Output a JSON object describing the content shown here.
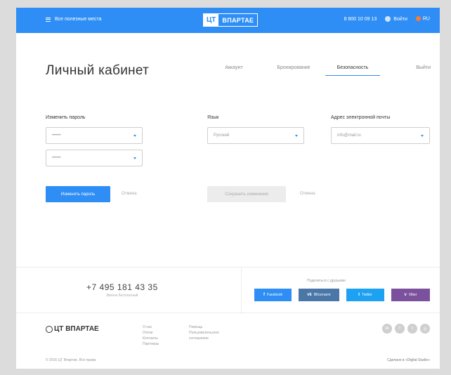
{
  "header": {
    "menu_label": "Все полезные места",
    "logo_a": "ЦТ",
    "logo_b": "ВПАРТАЕ",
    "phone": "8 800 10 09 13",
    "user": "Войти",
    "lang": "RU"
  },
  "page": {
    "title": "Личный кабинет",
    "tabs": [
      "Аккаунт",
      "Бронирование",
      "Безопасность",
      "Выйти"
    ]
  },
  "form": {
    "password_label": "Изменить пароль",
    "password_field_1": "••••••",
    "password_field_2": "••••••",
    "lang_label": "Язык",
    "lang_value": "Русский",
    "email_label": "Адрес электронной почты",
    "email_value": "info@mail.ru",
    "change_password_button": "Изменить пароль",
    "cancel_1": "Отмена",
    "save_changes_button": "Сохранить изменения",
    "cancel_2": "Отмена"
  },
  "footer": {
    "phone": "+7 495 181 43 35",
    "phone_sub": "Звонок бесплатный",
    "share_title": "Поделиться с друзьями",
    "share_buttons": [
      {
        "label": "Facebook",
        "icon": "f",
        "color": "#2f8ef5"
      },
      {
        "label": "ВКонтакте",
        "icon": "vk",
        "color": "#4a76a8"
      },
      {
        "label": "Twitter",
        "icon": "t",
        "color": "#1da1f2"
      },
      {
        "label": "Viber",
        "icon": "v",
        "color": "#7b519d"
      }
    ],
    "logo": "ЦТ ВПАРТАЕ",
    "col1": [
      "О нас",
      "Отели",
      "Контакты",
      "Партнеры"
    ],
    "col2": [
      "Помощь",
      "Пользовательское",
      "соглашение"
    ],
    "copyright": "© 2016 ЦТ Впартае. Все права",
    "developer": "Сделано в «Digital Studio»",
    "social_icons": [
      "vk-icon",
      "facebook-icon",
      "twitter-icon",
      "instagram-icon"
    ]
  },
  "colors": {
    "accent": "#2f8ef5",
    "background": "#dcdcdc"
  }
}
